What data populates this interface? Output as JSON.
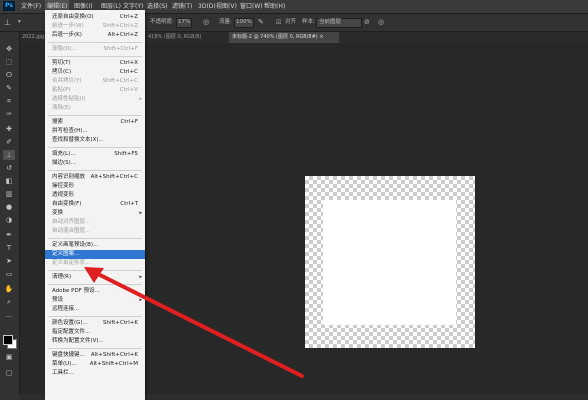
{
  "menubar": {
    "logo": "Ps",
    "items": [
      "文件(F)",
      "编辑(E)",
      "图像(I)",
      "图层(L)",
      "文字(Y)",
      "选择(S)",
      "滤镜(T)",
      "3D(D)",
      "视图(V)",
      "窗口(W)",
      "帮助(H)"
    ],
    "active_index": 1
  },
  "options": {
    "flow_label": "不透明度:",
    "flow_value": "17%",
    "smooth_label": "流量:",
    "smooth_value": "100%",
    "align_label": "对齐",
    "sample_label": "样本:",
    "sample_value": "当前图层"
  },
  "tabs": [
    {
      "label": "2022.jpg",
      "active": false
    },
    {
      "label": "418% (图层 0, RGB/8)",
      "active": false
    },
    {
      "label": "未标题-2 @ 740% (图层 0, RGB/8#) ×",
      "active": true
    }
  ],
  "edit_menu": [
    {
      "label": "还原自由变换(O)",
      "shortcut": "Ctrl+Z",
      "disabled": false
    },
    {
      "label": "前进一步(W)",
      "shortcut": "Shift+Ctrl+Z",
      "disabled": true
    },
    {
      "label": "后退一步(K)",
      "shortcut": "Alt+Ctrl+Z",
      "disabled": false
    },
    {
      "sep": true
    },
    {
      "label": "渐隐(D)...",
      "shortcut": "Shift+Ctrl+F",
      "disabled": true
    },
    {
      "sep": true
    },
    {
      "label": "剪切(T)",
      "shortcut": "Ctrl+X",
      "disabled": false
    },
    {
      "label": "拷贝(C)",
      "shortcut": "Ctrl+C",
      "disabled": false
    },
    {
      "label": "合并拷贝(Y)",
      "shortcut": "Shift+Ctrl+C",
      "disabled": true
    },
    {
      "label": "粘贴(P)",
      "shortcut": "Ctrl+V",
      "disabled": true
    },
    {
      "label": "选择性粘贴(I)",
      "shortcut": "",
      "disabled": true,
      "arrow": true
    },
    {
      "label": "清除(E)",
      "shortcut": "",
      "disabled": true
    },
    {
      "sep": true
    },
    {
      "label": "搜索",
      "shortcut": "Ctrl+F",
      "disabled": false
    },
    {
      "label": "拼写检查(H)...",
      "shortcut": "",
      "disabled": false
    },
    {
      "label": "查找和替换文本(X)...",
      "shortcut": "",
      "disabled": false
    },
    {
      "sep": true
    },
    {
      "label": "填充(L)...",
      "shortcut": "Shift+F5",
      "disabled": false
    },
    {
      "label": "描边(S)...",
      "shortcut": "",
      "disabled": false
    },
    {
      "sep": true
    },
    {
      "label": "内容识别缩放",
      "shortcut": "Alt+Shift+Ctrl+C",
      "disabled": false
    },
    {
      "label": "操控变形",
      "shortcut": "",
      "disabled": false
    },
    {
      "label": "透视变形",
      "shortcut": "",
      "disabled": false
    },
    {
      "label": "自由变换(F)",
      "shortcut": "Ctrl+T",
      "disabled": false
    },
    {
      "label": "变换",
      "shortcut": "",
      "disabled": false,
      "arrow": true
    },
    {
      "label": "自动对齐图层...",
      "shortcut": "",
      "disabled": true
    },
    {
      "label": "自动混合图层...",
      "shortcut": "",
      "disabled": true
    },
    {
      "sep": true
    },
    {
      "label": "定义画笔预设(B)...",
      "shortcut": "",
      "disabled": false
    },
    {
      "label": "定义图案...",
      "shortcut": "",
      "disabled": false,
      "selected": true
    },
    {
      "label": "定义自定形状...",
      "shortcut": "",
      "disabled": true
    },
    {
      "sep": true
    },
    {
      "label": "清理(R)",
      "shortcut": "",
      "disabled": false,
      "arrow": true
    },
    {
      "sep": true
    },
    {
      "label": "Adobe PDF 预设...",
      "shortcut": "",
      "disabled": false
    },
    {
      "label": "预设",
      "shortcut": "",
      "disabled": false,
      "arrow": true
    },
    {
      "label": "远程连接...",
      "shortcut": "",
      "disabled": false
    },
    {
      "sep": true
    },
    {
      "label": "颜色设置(G)...",
      "shortcut": "Shift+Ctrl+K",
      "disabled": false
    },
    {
      "label": "指定配置文件...",
      "shortcut": "",
      "disabled": false
    },
    {
      "label": "转换为配置文件(V)...",
      "shortcut": "",
      "disabled": false
    },
    {
      "sep": true
    },
    {
      "label": "键盘快捷键...",
      "shortcut": "Alt+Shift+Ctrl+K",
      "disabled": false
    },
    {
      "label": "菜单(U)...",
      "shortcut": "Alt+Shift+Ctrl+M",
      "disabled": false
    },
    {
      "label": "工具栏...",
      "shortcut": "",
      "disabled": false
    }
  ],
  "tools": [
    "move-tool-icon",
    "marquee-tool-icon",
    "lasso-tool-icon",
    "quick-select-tool-icon",
    "crop-tool-icon",
    "eyedropper-tool-icon",
    "healing-brush-tool-icon",
    "brush-tool-icon",
    "clone-stamp-tool-icon",
    "history-brush-tool-icon",
    "eraser-tool-icon",
    "gradient-tool-icon",
    "blur-tool-icon",
    "dodge-tool-icon",
    "pen-tool-icon",
    "type-tool-icon",
    "path-select-tool-icon",
    "rectangle-tool-icon",
    "hand-tool-icon",
    "zoom-tool-icon",
    "more-tools-icon"
  ],
  "colors": {
    "menu_highlight": "#2f76d2",
    "arrow": "#e02020",
    "app_bg": "#282828"
  }
}
